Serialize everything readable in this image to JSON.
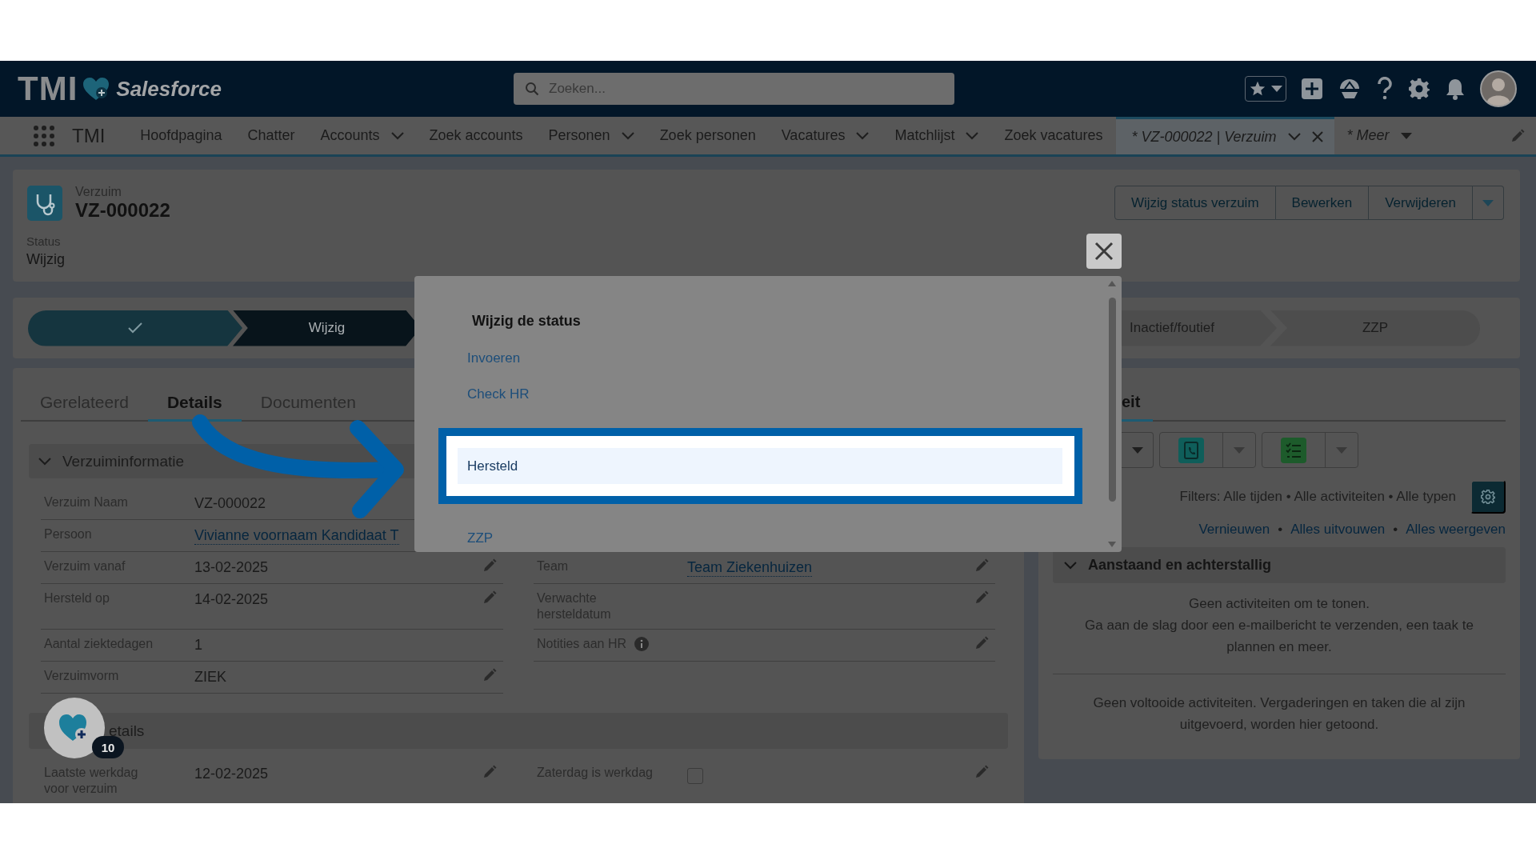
{
  "header": {
    "logo": {
      "brand": "TMI",
      "product": "Salesforce"
    },
    "search": {
      "placeholder": "Zoeken..."
    }
  },
  "nav": {
    "app_name": "TMI",
    "items": [
      {
        "label": "Hoofdpagina",
        "kind": "link",
        "selected": false
      },
      {
        "label": "Chatter",
        "kind": "link",
        "selected": false
      },
      {
        "label": "Accounts",
        "kind": "menu",
        "selected": false
      },
      {
        "label": "Zoek accounts",
        "kind": "link",
        "selected": false
      },
      {
        "label": "Personen",
        "kind": "menu",
        "selected": false
      },
      {
        "label": "Zoek personen",
        "kind": "link",
        "selected": false
      },
      {
        "label": "Vacatures",
        "kind": "menu",
        "selected": false
      },
      {
        "label": "Matchlijst",
        "kind": "menu",
        "selected": false
      },
      {
        "label": "Zoek vacatures",
        "kind": "link",
        "selected": false
      },
      {
        "label": "* VZ-000022 | Verzuim",
        "kind": "record",
        "selected": true
      },
      {
        "label": "* Meer",
        "kind": "more",
        "selected": false
      }
    ]
  },
  "record": {
    "object": "Verzuim",
    "name": "VZ-000022",
    "actions": [
      "Wijzig status verzuim",
      "Bewerken",
      "Verwijderen"
    ],
    "status_label": "Status",
    "status_value": "Wijzig"
  },
  "path": {
    "stages": [
      {
        "completed": true,
        "selected": false
      },
      {
        "label": "Wijzig",
        "completed": false,
        "selected": true
      },
      {
        "label": "Inactief/foutief",
        "completed": false,
        "selected": false
      },
      {
        "label": "ZZP",
        "completed": false,
        "selected": false
      }
    ]
  },
  "details": {
    "tabs": [
      {
        "label": "Gerelateerd",
        "selected": false
      },
      {
        "label": "Details",
        "selected": true
      },
      {
        "label": "Documenten",
        "selected": false
      }
    ],
    "sections": [
      {
        "title": "Verzuiminformatie",
        "expanded": true,
        "rows": [
          {
            "left": {
              "label": "Verzuim Naam",
              "value": "VZ-000022",
              "kind": "text",
              "editable": false
            }
          },
          {
            "left": {
              "label": "Persoon",
              "value": "Vivianne voornaam Kandidaat T",
              "kind": "link",
              "editable": false
            }
          },
          {
            "left": {
              "label": "Verzuim vanaf",
              "value": "13-02-2025",
              "kind": "text",
              "editable": true
            },
            "right": {
              "label": "Team",
              "value": "Team Ziekenhuizen",
              "kind": "link",
              "editable": true
            }
          },
          {
            "left": {
              "label": "Hersteld op",
              "value": "14-02-2025",
              "kind": "text",
              "editable": true
            },
            "right": {
              "label": "Verwachte hersteldatum",
              "kind": "text",
              "editable": true
            }
          },
          {
            "left": {
              "label": "Aantal ziektedagen",
              "value": "1",
              "kind": "text",
              "editable": false
            },
            "right": {
              "label": "Notities aan HR",
              "info": true,
              "kind": "text",
              "editable": true
            }
          },
          {
            "left": {
              "label": "Verzuimvorm",
              "value": "ZIEK",
              "kind": "text",
              "editable": true
            }
          }
        ]
      },
      {
        "title": "etails",
        "rows": [
          {
            "left": {
              "label": "Laatste werkdag voor verzuim",
              "value": "12-02-2025",
              "kind": "text",
              "editable": true
            },
            "right": {
              "label": "Zaterdag is werkdag",
              "kind": "checkbox",
              "checked": false,
              "editable": true
            }
          }
        ]
      }
    ]
  },
  "activity": {
    "tab": "eit",
    "filters": "Filters: Alle tijden • Alle activiteiten • Alle typen",
    "links": [
      "Vernieuwen",
      "Alles uitvouwen",
      "Alles weergeven"
    ],
    "separator": "•",
    "section": {
      "title": "Aanstaand en achterstallig",
      "expanded": true,
      "empty_lines": [
        "Geen activiteiten om te tonen.",
        "Ga aan de slag door een e-mailbericht te verzenden, een taak te plannen en meer."
      ]
    },
    "completed_text": "Geen voltooide activiteiten. Vergaderingen en taken die al zijn uitgevoerd, worden hier getoond."
  },
  "modal": {
    "title": "Wijzig de status",
    "items": [
      {
        "label": "Invoeren",
        "selected": false
      },
      {
        "label": "Check HR",
        "selected": false
      },
      {
        "label": "Hersteld",
        "selected": true
      },
      {
        "label": "ZZP",
        "selected": false
      }
    ]
  },
  "floating_button": {
    "badge": "10"
  }
}
